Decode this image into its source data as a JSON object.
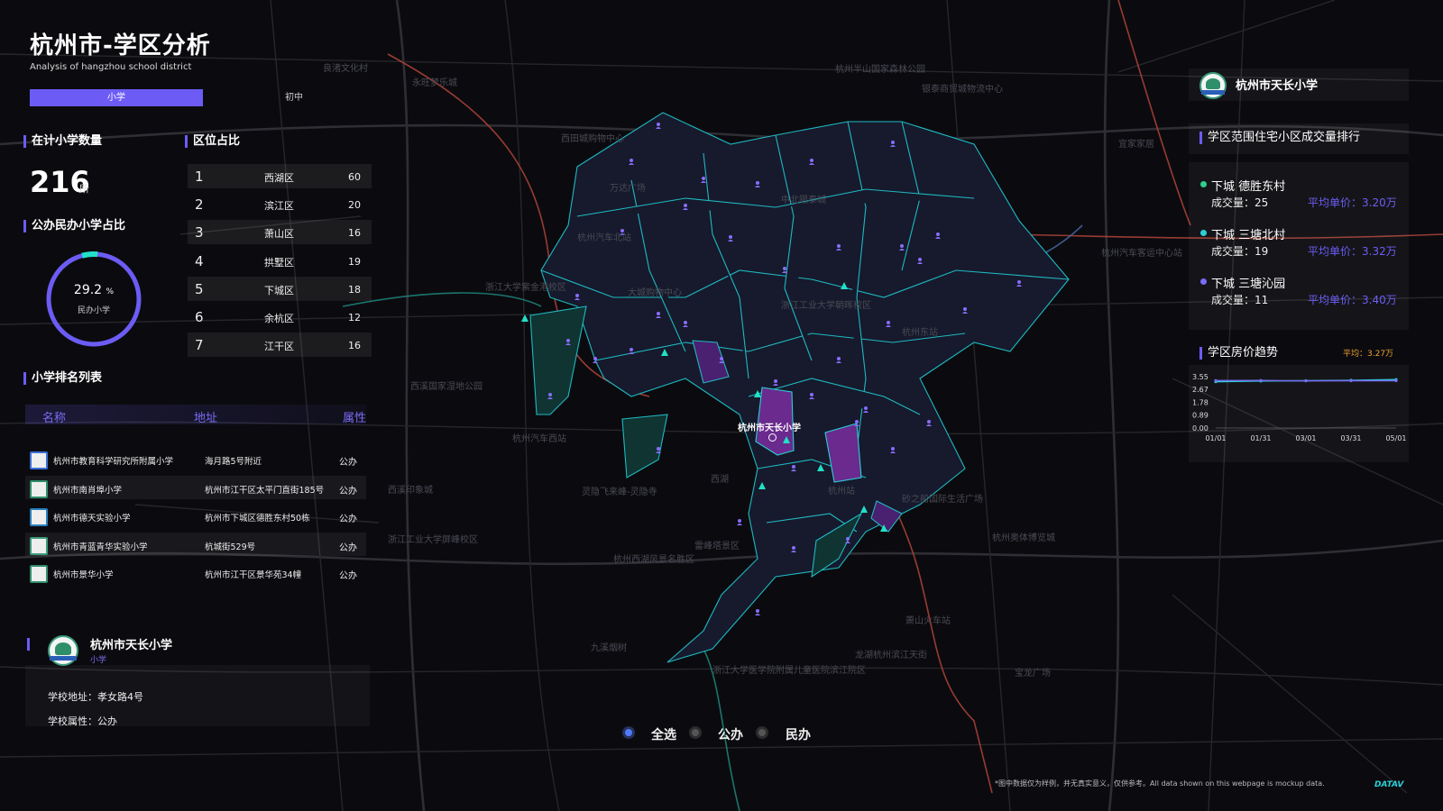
{
  "header": {
    "title": "杭州市-学区分析",
    "subtitle": "Analysis of hangzhou school district",
    "tabs": [
      {
        "label": "小学",
        "active": true
      },
      {
        "label": "初中",
        "active": false
      }
    ]
  },
  "stats": {
    "count_title": "在计小学数量",
    "count_value": "216",
    "count_unit": "所",
    "ratio_title": "公办民办小学占比",
    "ratio_value": "29.2",
    "ratio_unit": "%",
    "ratio_fraction": 0.292,
    "ratio_label": "民办小学"
  },
  "district_ratio": {
    "title": "区位占比",
    "rows": [
      {
        "rank": "1",
        "name": "西湖区",
        "value": "60"
      },
      {
        "rank": "2",
        "name": "滨江区",
        "value": "20"
      },
      {
        "rank": "3",
        "name": "萧山区",
        "value": "16"
      },
      {
        "rank": "4",
        "name": "拱墅区",
        "value": "19"
      },
      {
        "rank": "5",
        "name": "下城区",
        "value": "18"
      },
      {
        "rank": "6",
        "name": "余杭区",
        "value": "12"
      },
      {
        "rank": "7",
        "name": "江干区",
        "value": "16"
      }
    ]
  },
  "school_list": {
    "title": "小学排名列表",
    "columns": [
      "名称",
      "地址",
      "属性"
    ],
    "rows": [
      {
        "name": "杭州市教育科学研究所附属小学",
        "address": "海月路5号附近",
        "type": "公办"
      },
      {
        "name": "杭州市南肖埠小学",
        "address": "杭州市江干区太平门直街185号",
        "type": "公办"
      },
      {
        "name": "杭州市德天实验小学",
        "address": "杭州市下城区德胜东村50栋",
        "type": "公办"
      },
      {
        "name": "杭州市青蓝青华实验小学",
        "address": "杭城街529号",
        "type": "公办"
      },
      {
        "name": "杭州市景华小学",
        "address": "杭州市江干区景华苑34幢",
        "type": "公办"
      }
    ]
  },
  "school_card": {
    "name": "杭州市天长小学",
    "category": "小学",
    "address_label": "学校地址：",
    "address": "孝女路4号",
    "type_label": "学校属性：",
    "type": "公办"
  },
  "right_panel": {
    "school_name": "杭州市天长小学",
    "ranking_title": "学区范围住宅小区成交量排行",
    "ranking": [
      {
        "name": "下城 德胜东村",
        "volume_label": "成交量：25",
        "price_label": "平均单价：3.20万",
        "color": "#2fd08a"
      },
      {
        "name": "下城 三塘北村",
        "volume_label": "成交量：19",
        "price_label": "平均单价：3.32万",
        "color": "#2ad0d8"
      },
      {
        "name": "下城 三塘沁园",
        "volume_label": "成交量：11",
        "price_label": "平均单价：3.40万",
        "color": "#7b6cf6"
      }
    ],
    "trend_title": "学区房价趋势",
    "trend_avg": "平均：3.27万"
  },
  "chart_data": {
    "type": "line",
    "title": "学区房价趋势",
    "x": [
      "01/01",
      "01/31",
      "03/01",
      "03/31",
      "05/01"
    ],
    "yticks": [
      "3.55",
      "2.67",
      "1.78",
      "0.89",
      "0.00"
    ],
    "ylim": [
      0,
      3.55
    ],
    "series": [
      {
        "values": [
          3.2,
          3.25,
          3.27,
          3.3,
          3.35
        ],
        "color": "#2ad0d8"
      },
      {
        "values": [
          3.28,
          3.29,
          3.26,
          3.27,
          3.27
        ],
        "color": "#7b6cf6"
      }
    ],
    "average": 3.27
  },
  "map": {
    "highlight_label": "杭州市天长小学",
    "places": [
      {
        "text": "西田城购物中心"
      },
      {
        "text": "万达广场"
      },
      {
        "text": "杭州汽车北站"
      },
      {
        "text": "浙江大学紫金港校区"
      },
      {
        "text": "大城购物中心"
      },
      {
        "text": "浙江工业大学朝晖校区"
      },
      {
        "text": "杭州东站"
      },
      {
        "text": "西溪国家湿地公园"
      },
      {
        "text": "杭州汽车西站"
      },
      {
        "text": "西湖"
      },
      {
        "text": "灵隐飞来峰-灵隐寺"
      },
      {
        "text": "杭州西湖风景名胜区"
      },
      {
        "text": "雷峰塔景区"
      },
      {
        "text": "九溪烟树"
      },
      {
        "text": "浙江大学医学院附属儿童医院滨江院区"
      },
      {
        "text": "龙湖杭州滨江天街"
      },
      {
        "text": "宝龙广场"
      },
      {
        "text": "杭州奥体博览城"
      },
      {
        "text": "砂之船国际生活广场"
      },
      {
        "text": "杭州汽车客运中心站"
      },
      {
        "text": "宜家家居"
      },
      {
        "text": "杭州半山国家森林公园"
      },
      {
        "text": "银泰商贸城物流中心"
      },
      {
        "text": "永旺梦乐城"
      },
      {
        "text": "良渚文化村"
      },
      {
        "text": "中北银泰城"
      },
      {
        "text": "西溪印象城"
      },
      {
        "text": "浙江工业大学屏峰校区"
      },
      {
        "text": "萧山火车站"
      },
      {
        "text": "杭州站"
      }
    ]
  },
  "legend": {
    "options": [
      {
        "label": "全选",
        "active": true
      },
      {
        "label": "公办",
        "active": false
      },
      {
        "label": "民办",
        "active": false
      }
    ]
  },
  "footer": {
    "note": "*图中数据仅为样例，并无真实意义，仅供参考。All data shown on this webpage is mockup data.",
    "brand": "DATAV"
  }
}
